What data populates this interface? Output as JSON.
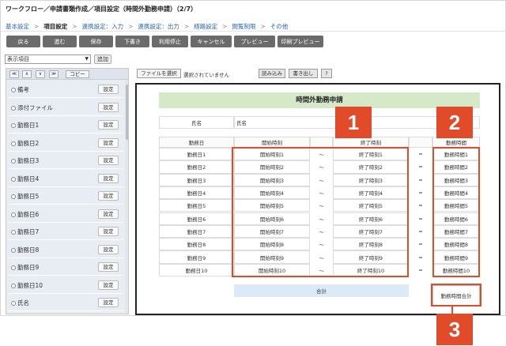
{
  "window_title": "ワークフロー／申請書類作成／項目設定（時間外勤務申請）（2/7）",
  "steps": [
    "基本設定",
    "項目設定",
    "連携設定：入力",
    "連携設定：出力",
    "経路設定",
    "閲覧制限",
    "その他"
  ],
  "active_step": "項目設定",
  "step_separator": ">",
  "toolbar": [
    "戻る",
    "進む",
    "保存",
    "下書き",
    "利用停止",
    "キャンセル",
    "プレビュー",
    "印刷プレビュー"
  ],
  "item_select": {
    "value": "表示項目"
  },
  "add_button": "追加",
  "list_nav": {
    "up_all": "≪",
    "up": "∧",
    "down": "∨",
    "down_all": "≫",
    "copy": "コピー"
  },
  "left_items": [
    "備考",
    "添付ファイル",
    "勤務日1",
    "勤務日2",
    "勤務日3",
    "勤務日4",
    "勤務日5",
    "勤務日6",
    "勤務日7",
    "勤務日8",
    "勤務日9",
    "勤務日10",
    "氏名"
  ],
  "set_button_label": "設定",
  "file_area": {
    "choose": "ファイルを選択",
    "status": "選択されていません",
    "load": "読み込み",
    "export": "書き出し",
    "help": "?"
  },
  "form": {
    "title": "時間外勤務申請",
    "name_label": "氏名",
    "name_value": "氏名",
    "headers": {
      "date": "勤務日",
      "start": "開始時刻",
      "end": "終了時刻",
      "hours": "勤務時間"
    },
    "rows": [
      {
        "date": "勤務日1",
        "start": "開始時刻1",
        "end": "終了時刻1",
        "hours": "勤務時間1"
      },
      {
        "date": "勤務日2",
        "start": "開始時刻2",
        "end": "終了時刻2",
        "hours": "勤務時間2"
      },
      {
        "date": "勤務日3",
        "start": "開始時刻3",
        "end": "終了時刻3",
        "hours": "勤務時間3"
      },
      {
        "date": "勤務日4",
        "start": "開始時刻4",
        "end": "終了時刻4",
        "hours": "勤務時間4"
      },
      {
        "date": "勤務日5",
        "start": "開始時刻5",
        "end": "終了時刻5",
        "hours": "勤務時間5"
      },
      {
        "date": "勤務日6",
        "start": "開始時刻6",
        "end": "終了時刻6",
        "hours": "勤務時間6"
      },
      {
        "date": "勤務日7",
        "start": "開始時刻7",
        "end": "終了時刻7",
        "hours": "勤務時間7"
      },
      {
        "date": "勤務日8",
        "start": "開始時刻8",
        "end": "終了時刻8",
        "hours": "勤務時間8"
      },
      {
        "date": "勤務日9",
        "start": "開始時刻9",
        "end": "終了時刻9",
        "hours": "勤務時間9"
      },
      {
        "date": "勤務日10",
        "start": "開始時刻10",
        "end": "終了時刻10",
        "hours": "勤務時間10"
      }
    ],
    "tilde": "～",
    "equals": "=",
    "total_label": "合計",
    "total_hours": "勤務時間合計"
  },
  "callouts": [
    "1",
    "2",
    "3"
  ],
  "colors": {
    "accent_red": "#e24b2a",
    "title_green": "#d5e8c8",
    "sum_blue": "#dce9f6",
    "toolbar_gray": "#6b6b6b"
  }
}
